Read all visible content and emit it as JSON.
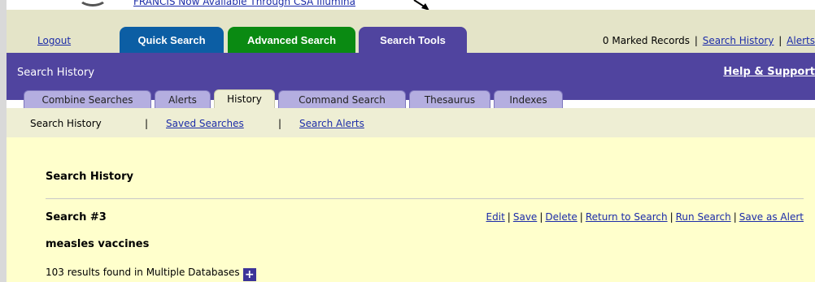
{
  "banner": {
    "text": "FRANCIS Now Available Through CSA Illumina"
  },
  "topnav": {
    "logout": "Logout",
    "tabs": [
      "Quick Search",
      "Advanced Search",
      "Search Tools"
    ],
    "marked": "0 Marked Records",
    "search_history": "Search History",
    "alerts": "Alerts"
  },
  "header": {
    "title": "Search History",
    "help": "Help & Support"
  },
  "subtabs": [
    "Combine Searches",
    "Alerts",
    "History",
    "Command Search",
    "Thesaurus",
    "Indexes"
  ],
  "subnav": {
    "current": "Search History",
    "saved": "Saved Searches",
    "alerts": "Search Alerts",
    "sep": "|"
  },
  "content": {
    "title": "Search History",
    "search_label": "Search #3",
    "actions": [
      "Edit",
      "Save",
      "Delete",
      "Return to Search",
      "Run Search",
      "Save as Alert"
    ],
    "query": "measles vaccines",
    "results": "103 results found in Multiple Databases",
    "plus": "+"
  },
  "colors": {
    "purple": "#50449f",
    "blue_tab": "#0c5ea4",
    "green_tab": "#0a8a12",
    "content_bg": "#ffffcc"
  },
  "icons": [
    "arrow-pointer-icon",
    "plus-icon"
  ]
}
